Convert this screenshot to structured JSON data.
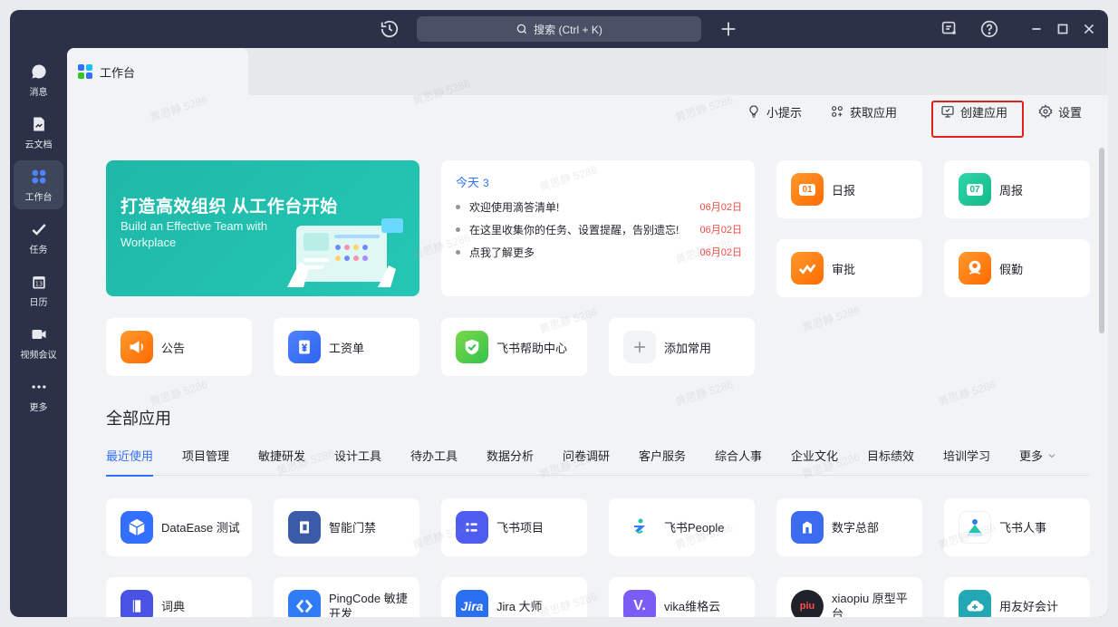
{
  "search": {
    "label": "搜索 (Ctrl + K)"
  },
  "sidebar": {
    "items": [
      {
        "label": "消息",
        "icon": "message-icon"
      },
      {
        "label": "云文档",
        "icon": "document-icon"
      },
      {
        "label": "工作台",
        "icon": "workspace-icon",
        "active": true
      },
      {
        "label": "任务",
        "icon": "task-icon"
      },
      {
        "label": "日历",
        "icon": "calendar-icon"
      },
      {
        "label": "视频会议",
        "icon": "video-icon"
      },
      {
        "label": "更多",
        "icon": "more-icon"
      }
    ]
  },
  "tab": {
    "title": "工作台"
  },
  "toolbar": {
    "tips": "小提示",
    "get_app": "获取应用",
    "create_app": "创建应用",
    "settings": "设置"
  },
  "banner": {
    "title": "打造高效组织 从工作台开始",
    "subtitle": "Build an Effective Team with Workplace"
  },
  "today": {
    "title": "今天",
    "count": "3",
    "items": [
      {
        "text": "欢迎使用滴答清单!",
        "date": "06月02日"
      },
      {
        "text": "在这里收集你的任务、设置提醒，告别遗忘!",
        "date": "06月02日"
      },
      {
        "text": "点我了解更多",
        "date": "06月02日"
      }
    ]
  },
  "quick": {
    "daily": "日报",
    "weekly": "周报",
    "approval": "审批",
    "leave": "假勤",
    "notice": "公告",
    "payroll": "工资单",
    "help": "飞书帮助中心",
    "add": "添加常用",
    "daily_badge": "01",
    "weekly_badge": "07"
  },
  "all_apps": {
    "title": "全部应用",
    "categories": [
      "最近使用",
      "项目管理",
      "敏捷研发",
      "设计工具",
      "待办工具",
      "数据分析",
      "问卷调研",
      "客户服务",
      "综合人事",
      "企业文化",
      "目标绩效",
      "培训学习",
      "更多"
    ],
    "apps": [
      {
        "label": "DataEase 测试",
        "color": "#3370ff"
      },
      {
        "label": "智能门禁",
        "color": "#3b5aa8"
      },
      {
        "label": "飞书项目",
        "color": "#4f5cf0"
      },
      {
        "label": "飞书People",
        "color": "#ffffff"
      },
      {
        "label": "数字总部",
        "color": "#3b6cf0"
      },
      {
        "label": "飞书人事",
        "color": "#ffffff"
      },
      {
        "label": "词典",
        "color": "#4a52e6"
      },
      {
        "label": "PingCode 敏捷开发",
        "color": "#2f7cf6"
      },
      {
        "label": "Jira 大师",
        "color": "#2a6ff0"
      },
      {
        "label": "vika维格云",
        "color": "#7b5cf5"
      },
      {
        "label": "xiaopiu 原型平台",
        "color": "#1f2329"
      },
      {
        "label": "用友好会计",
        "color": "#22a7b5"
      }
    ]
  },
  "watermark": "黄思静 5286"
}
